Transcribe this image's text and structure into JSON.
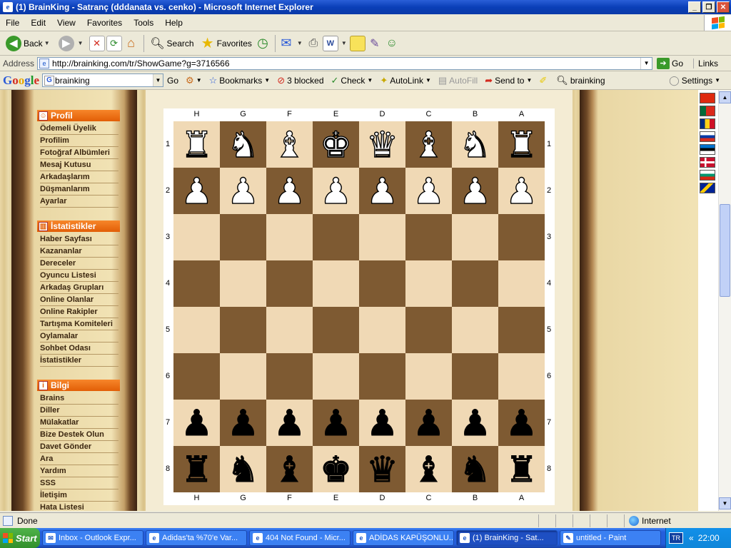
{
  "window": {
    "title": "(1) BrainKing - Satranç (dddanata vs. cenko) - Microsoft Internet Explorer"
  },
  "menu": [
    "File",
    "Edit",
    "View",
    "Favorites",
    "Tools",
    "Help"
  ],
  "toolbar": {
    "back": "Back",
    "search": "Search",
    "favorites": "Favorites"
  },
  "address": {
    "label": "Address",
    "url": "http://brainking.com/tr/ShowGame?g=3716566",
    "go": "Go",
    "links": "Links"
  },
  "google": {
    "logo": [
      "G",
      "o",
      "o",
      "g",
      "l",
      "e"
    ],
    "query": "brainking",
    "go": "Go",
    "bookmarks": "Bookmarks",
    "blocked": "3 blocked",
    "check": "Check",
    "autolink": "AutoLink",
    "autofill": "AutoFill",
    "sendto": "Send to",
    "highlight": "brainking",
    "settings": "Settings"
  },
  "sidebar": {
    "sections": [
      {
        "title": "Profil",
        "items": [
          "Ödemeli Üyelik",
          "Profilim",
          "Fotoğraf Albümleri",
          "Mesaj Kutusu",
          "Arkadaşlarım",
          "Düşmanlarım",
          "Ayarlar"
        ]
      },
      {
        "title": "İstatistikler",
        "items": [
          "Haber Sayfası",
          "Kazananlar",
          "Dereceler",
          "Oyuncu Listesi",
          "Arkadaş Grupları",
          "Online Olanlar",
          "Online Rakipler",
          "Tartışma Komiteleri",
          "Oylamalar",
          "Sohbet Odası",
          "İstatistikler"
        ]
      },
      {
        "title": "Bilgi",
        "items": [
          "Brains",
          "Diller",
          "Mülakatlar",
          "Bize Destek Olun",
          "Davet Gönder",
          "Ara",
          "Yardım",
          "SSS",
          "İletişim",
          "Hata Listesi"
        ]
      }
    ]
  },
  "board": {
    "files": [
      "H",
      "G",
      "F",
      "E",
      "D",
      "C",
      "B",
      "A"
    ],
    "ranks": [
      "1",
      "2",
      "3",
      "4",
      "5",
      "6",
      "7",
      "8"
    ],
    "rows": [
      [
        "♜",
        "♞",
        "♝",
        "♚",
        "♛",
        "♝",
        "♞",
        "♜"
      ],
      [
        "♟",
        "♟",
        "♟",
        "♟",
        "♟",
        "♟",
        "♟",
        "♟"
      ],
      [
        "",
        "",
        "",
        "",
        "",
        "",
        "",
        ""
      ],
      [
        "",
        "",
        "",
        "",
        "",
        "",
        "",
        ""
      ],
      [
        "",
        "",
        "",
        "",
        "",
        "",
        "",
        ""
      ],
      [
        "",
        "",
        "",
        "",
        "",
        "",
        "",
        ""
      ],
      [
        "♟",
        "♟",
        "♟",
        "♟",
        "♟",
        "♟",
        "♟",
        "♟"
      ],
      [
        "♜",
        "♞",
        "♝",
        "♚",
        "♛",
        "♝",
        "♞",
        "♜"
      ]
    ],
    "colors": [
      "w",
      "w",
      "",
      "",
      "",
      "",
      "b",
      "b"
    ],
    "light_color": "#f0d9b5",
    "dark_color": "#7e5a32"
  },
  "status": {
    "text": "Done",
    "zone": "Internet"
  },
  "taskbar": {
    "start": "Start",
    "tasks": [
      "Inbox - Outlook Expr...",
      "Adidas'ta %70'e Var...",
      "404 Not Found - Micr...",
      "ADİDAS KAPÜŞONLU...",
      "(1) BrainKing - Sat...",
      "untitled - Paint"
    ],
    "active_index": 4,
    "lang": "TR",
    "clock": "22:00"
  }
}
